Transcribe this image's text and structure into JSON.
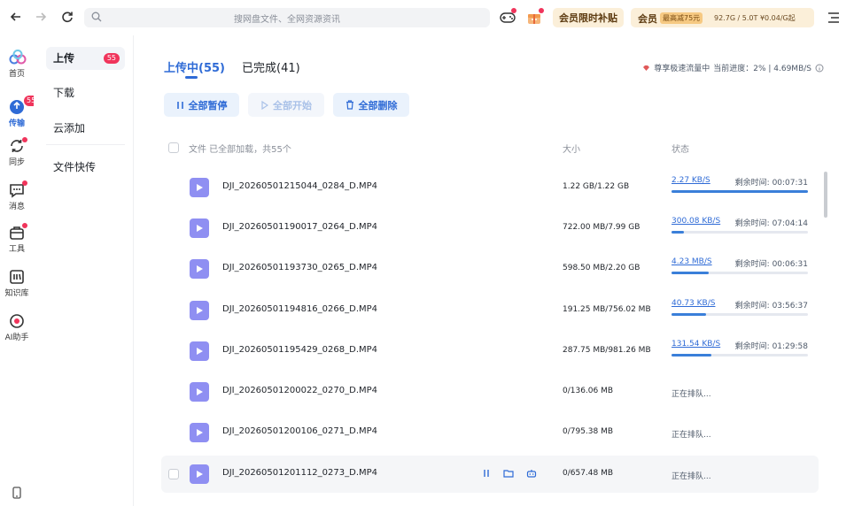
{
  "topbar": {
    "search_placeholder": "搜网盘文件、全网资源资讯",
    "vip_promo": "会员限时补贴",
    "vip_label": "会员",
    "vip_tag": "最高减75元",
    "vip_quota": "92.7G / 5.0T ¥0.04/G起",
    "back_icon": "arrow-left-icon",
    "forward_icon": "arrow-right-icon",
    "refresh_icon": "refresh-icon",
    "game_icon": "gamepad-icon",
    "gift_icon": "gift-icon",
    "menu_icon": "menu-icon"
  },
  "rail": {
    "items": [
      {
        "label": "首页",
        "icon": "home-cloud-icon"
      },
      {
        "label": "传输",
        "icon": "transfer-icon",
        "badge": "55"
      },
      {
        "label": "同步",
        "icon": "sync-icon"
      },
      {
        "label": "消息",
        "icon": "message-icon"
      },
      {
        "label": "工具",
        "icon": "tools-icon"
      },
      {
        "label": "知识库",
        "icon": "knowledge-icon"
      },
      {
        "label": "AI助手",
        "icon": "ai-assistant-icon"
      }
    ]
  },
  "sidebar": {
    "items": [
      {
        "label": "上传",
        "count": "55"
      },
      {
        "label": "下载"
      },
      {
        "label": "云添加"
      },
      {
        "label": "文件快传"
      }
    ]
  },
  "main": {
    "tabs": [
      {
        "label": "上传中(55)"
      },
      {
        "label": "已完成(41)"
      }
    ],
    "speed_text": "尊享极速流量中",
    "progress_text": "当前进度：2% | 4.69MB/S",
    "buttons": {
      "pause_all": "全部暂停",
      "start_all": "全部开始",
      "delete_all": "全部删除"
    },
    "header": {
      "file": "文件 已全部加载，共55个",
      "size": "大小",
      "status": "状态"
    },
    "rows": [
      {
        "name": "DJI_20260501215044_0284_D.MP4",
        "size": "1.22 GB/1.22 GB",
        "speed": "2.27 KB/S",
        "remain": "剩余时间: 00:07:31",
        "progress": 1.0
      },
      {
        "name": "DJI_20260501190017_0264_D.MP4",
        "size": "722.00 MB/7.99 GB",
        "speed": "300.08 KB/S",
        "remain": "剩余时间: 07:04:14",
        "progress": 0.09
      },
      {
        "name": "DJI_20260501193730_0265_D.MP4",
        "size": "598.50 MB/2.20 GB",
        "speed": "4.23 MB/S",
        "remain": "剩余时间: 00:06:31",
        "progress": 0.27
      },
      {
        "name": "DJI_20260501194816_0266_D.MP4",
        "size": "191.25 MB/756.02 MB",
        "speed": "40.73 KB/S",
        "remain": "剩余时间: 03:56:37",
        "progress": 0.25
      },
      {
        "name": "DJI_20260501195429_0268_D.MP4",
        "size": "287.75 MB/981.26 MB",
        "speed": "131.54 KB/S",
        "remain": "剩余时间: 01:29:58",
        "progress": 0.29
      },
      {
        "name": "DJI_20260501200022_0270_D.MP4",
        "size": "0/136.06 MB",
        "status": "正在排队..."
      },
      {
        "name": "DJI_20260501200106_0271_D.MP4",
        "size": "0/795.38 MB",
        "status": "正在排队..."
      },
      {
        "name": "DJI_20260501201112_0273_D.MP4",
        "size": "0/657.48 MB",
        "status": "正在排队..."
      }
    ]
  },
  "colors": {
    "accent": "#2f6bd6",
    "badge": "#f0345b",
    "file_icon": "#8f8ff2",
    "vip_bg": "#fbefd9"
  }
}
